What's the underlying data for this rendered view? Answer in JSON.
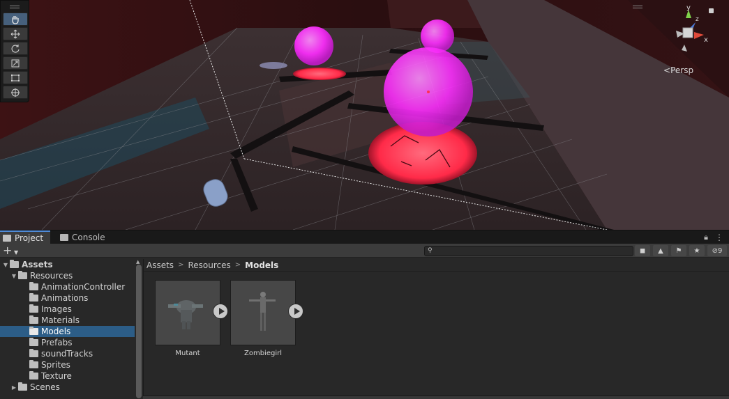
{
  "scene": {
    "gizmo": {
      "x_label": "x",
      "y_label": "y",
      "z_label": "z",
      "projection_label": "Persp"
    },
    "colors": {
      "orb": "#ff3cff",
      "floor": "#3a2626",
      "glow": "#ff3a5a",
      "wall": "#4a1a1c"
    }
  },
  "tools": [
    {
      "name": "hand-tool-icon",
      "active": true
    },
    {
      "name": "move-tool-icon",
      "active": false
    },
    {
      "name": "rotate-tool-icon",
      "active": false
    },
    {
      "name": "scale-tool-icon",
      "active": false
    },
    {
      "name": "rect-tool-icon",
      "active": false
    },
    {
      "name": "transform-tool-icon",
      "active": false
    }
  ],
  "tabs": {
    "project": "Project",
    "console": "Console"
  },
  "toolbar": {
    "add_label": "+",
    "search_placeholder": "",
    "hidden_count": "9"
  },
  "tree": {
    "assets": "Assets",
    "resources": "Resources",
    "items": [
      "AnimationController",
      "Animations",
      "Images",
      "Materials",
      "Models",
      "Prefabs",
      "soundTracks",
      "Sprites",
      "Texture"
    ],
    "selected": "Models",
    "scenes": "Scenes"
  },
  "breadcrumb": [
    "Assets",
    "Resources",
    "Models"
  ],
  "assets": [
    {
      "name": "Mutant"
    },
    {
      "name": "Zombiegirl"
    }
  ]
}
